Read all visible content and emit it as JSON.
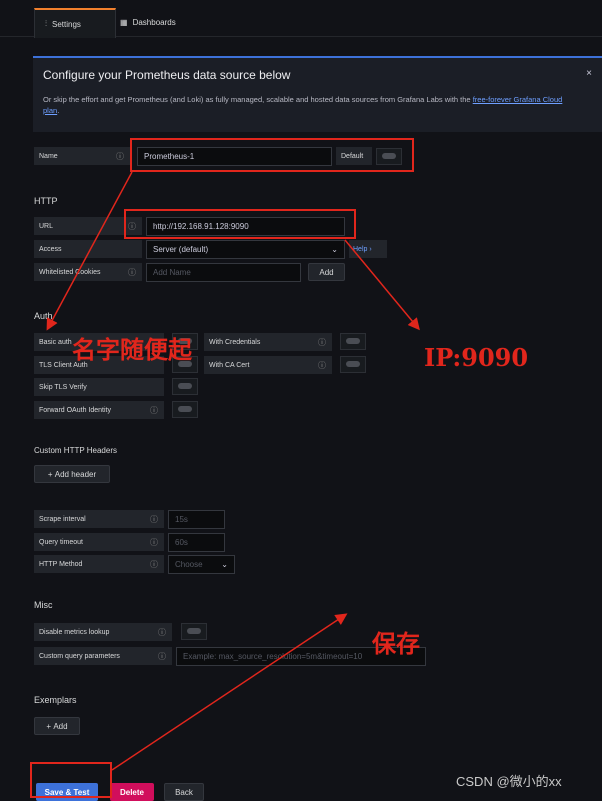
{
  "tabs": [
    {
      "label": "Settings",
      "icon": "sliders-icon"
    },
    {
      "label": "Dashboards",
      "icon": "dashboard-grid-icon"
    }
  ],
  "banner": {
    "title": "Configure your Prometheus data source below",
    "text": "Or skip the effort and get Prometheus (and Loki) as fully managed, scalable and hosted data sources from Grafana Labs with the ",
    "link": "free-forever Grafana Cloud plan",
    "end": ".",
    "close": "×"
  },
  "name": {
    "label": "Name",
    "value": "Prometheus-1",
    "default_label": "Default"
  },
  "http": {
    "heading": "HTTP",
    "url_label": "URL",
    "url_value": "http://192.168.91.128:9090",
    "access_label": "Access",
    "access_value": "Server (default)",
    "help": "Help",
    "cookies_label": "Whitelisted Cookies",
    "cookies_placeholder": "Add Name",
    "add_button": "Add"
  },
  "auth": {
    "heading": "Auth",
    "basic_auth": "Basic auth",
    "with_credentials": "With Credentials",
    "tls_client_auth": "TLS Client Auth",
    "with_ca_cert": "With CA Cert",
    "skip_tls_verify": "Skip TLS Verify",
    "forward_oauth": "Forward OAuth Identity"
  },
  "custom_headers": {
    "heading": "Custom HTTP Headers",
    "add_header": "Add header"
  },
  "prom": {
    "scrape_label": "Scrape interval",
    "scrape_placeholder": "15s",
    "query_timeout_label": "Query timeout",
    "query_timeout_placeholder": "60s",
    "http_method_label": "HTTP Method",
    "http_method_placeholder": "Choose"
  },
  "misc": {
    "heading": "Misc",
    "disable_lookup": "Disable metrics lookup",
    "custom_query_label": "Custom query parameters",
    "custom_query_placeholder": "Example: max_source_resolution=5m&timeout=10"
  },
  "exemplars": {
    "heading": "Exemplars",
    "add": "Add"
  },
  "actions": {
    "save": "Save & Test",
    "delete": "Delete",
    "back": "Back"
  },
  "annotations": {
    "name_note": "名字随便起",
    "ip_note": "IP:9090",
    "save_note": "保存"
  },
  "watermark": "CSDN @微小的xx",
  "colors": {
    "accent": "#3d71d9",
    "danger": "#d10e5c",
    "annotation": "#e1261c",
    "tab_active": "#f2802d"
  }
}
